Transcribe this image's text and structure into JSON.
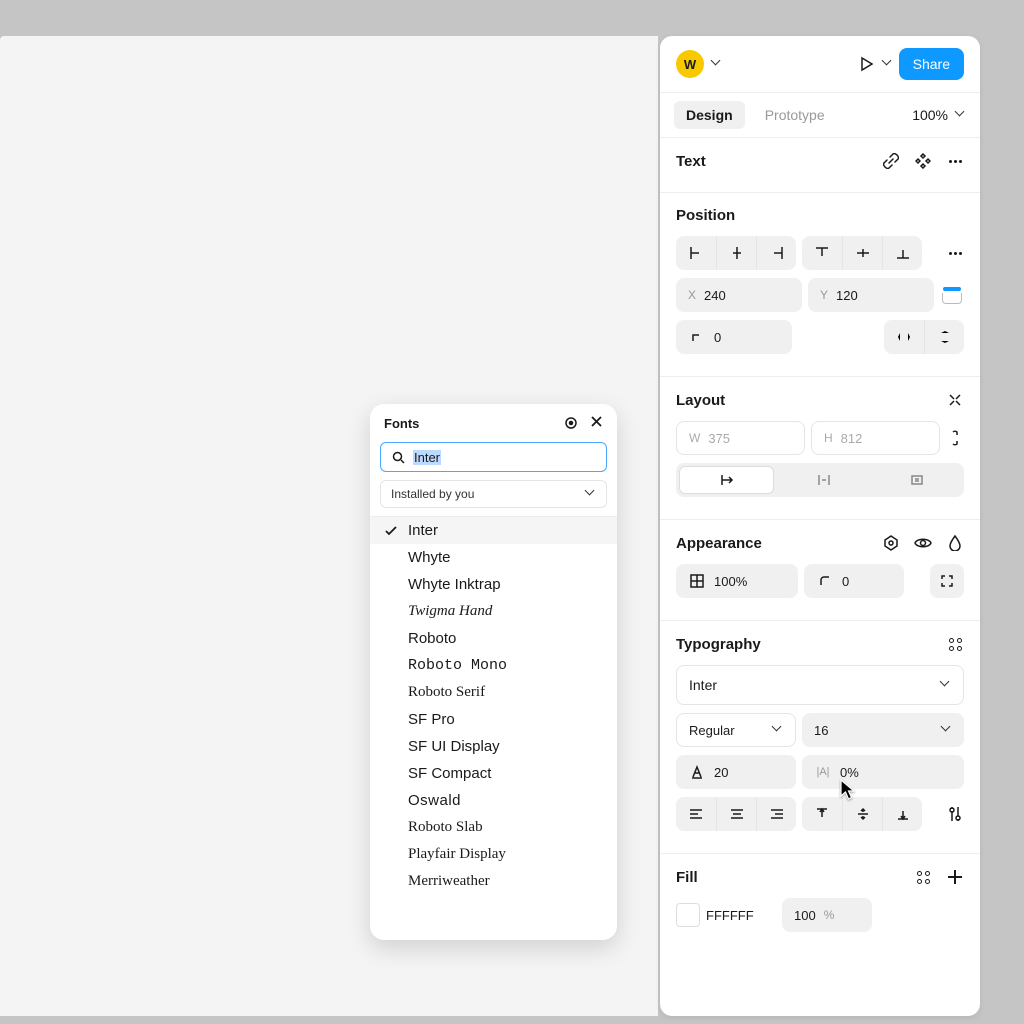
{
  "header": {
    "avatar_initial": "W",
    "share_label": "Share"
  },
  "tabs": {
    "design_label": "Design",
    "prototype_label": "Prototype",
    "zoom_label": "100%"
  },
  "text_section": {
    "title": "Text"
  },
  "position": {
    "title": "Position",
    "x_label": "X",
    "x_value": "240",
    "y_label": "Y",
    "y_value": "120",
    "rotation_value": "0"
  },
  "layout": {
    "title": "Layout",
    "w_label": "W",
    "w_value": "375",
    "h_label": "H",
    "h_value": "812"
  },
  "appearance": {
    "title": "Appearance",
    "opacity_value": "100%",
    "radius_value": "0"
  },
  "typography": {
    "title": "Typography",
    "font_family": "Inter",
    "weight": "Regular",
    "size": "16",
    "line_height": "20",
    "letter_spacing": "0%"
  },
  "fill": {
    "title": "Fill",
    "color_hex": "FFFFFF",
    "opacity": "100",
    "unit": "%"
  },
  "fonts_popup": {
    "title": "Fonts",
    "search_value": "Inter",
    "filter_label": "Installed by you",
    "items": [
      {
        "name": "Inter",
        "style": "",
        "selected": true
      },
      {
        "name": "Whyte",
        "style": "",
        "selected": false
      },
      {
        "name": "Whyte Inktrap",
        "style": "",
        "selected": false
      },
      {
        "name": "Twigma Hand",
        "style": "script",
        "selected": false
      },
      {
        "name": "Roboto",
        "style": "",
        "selected": false
      },
      {
        "name": "Roboto Mono",
        "style": "mono",
        "selected": false
      },
      {
        "name": "Roboto Serif",
        "style": "serif",
        "selected": false
      },
      {
        "name": "SF Pro",
        "style": "",
        "selected": false
      },
      {
        "name": "SF UI Display",
        "style": "",
        "selected": false
      },
      {
        "name": "SF Compact",
        "style": "",
        "selected": false
      },
      {
        "name": "Oswald",
        "style": "cond",
        "selected": false
      },
      {
        "name": "Roboto Slab",
        "style": "slab",
        "selected": false
      },
      {
        "name": "Playfair Display",
        "style": "serif",
        "selected": false
      },
      {
        "name": "Merriweather",
        "style": "serif",
        "selected": false
      }
    ]
  }
}
